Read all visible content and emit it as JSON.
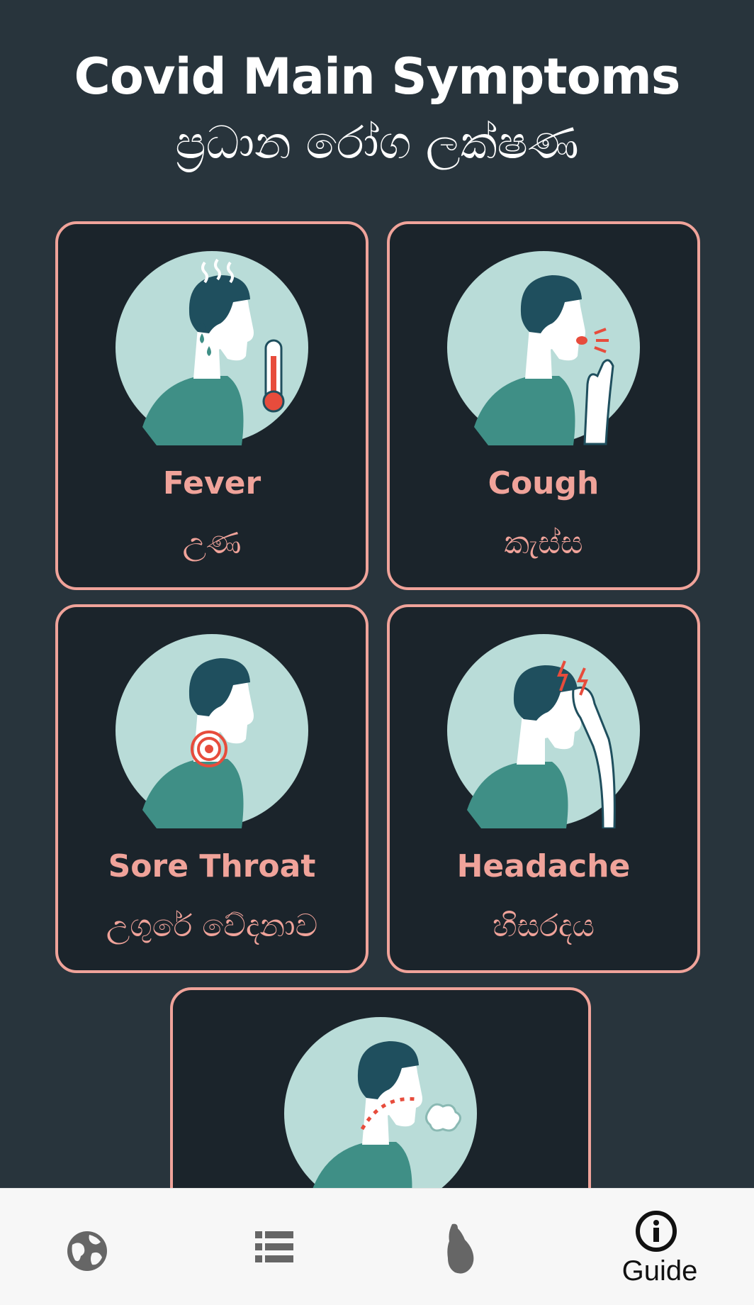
{
  "header": {
    "title_en": "Covid Main Symptoms",
    "title_si": "ප්‍රධාන රෝග ලක්ෂණ"
  },
  "symptoms": [
    {
      "name_en": "Fever",
      "name_si": "උණ",
      "icon": "fever-illustration"
    },
    {
      "name_en": "Cough",
      "name_si": "කැස්ස",
      "icon": "cough-illustration"
    },
    {
      "name_en": "Sore Throat",
      "name_si": "උගුරේ වේදනාව",
      "icon": "sore-throat-illustration"
    },
    {
      "name_en": "Headache",
      "name_si": "හිසරදය",
      "icon": "headache-illustration"
    },
    {
      "name_en": "",
      "name_si": "",
      "icon": "breathing-difficulty-illustration"
    }
  ],
  "bottom_nav": {
    "items": [
      {
        "icon": "globe-icon",
        "label": ""
      },
      {
        "icon": "list-icon",
        "label": ""
      },
      {
        "icon": "sri-lanka-map-icon",
        "label": ""
      },
      {
        "icon": "info-icon",
        "label": "Guide",
        "active": true
      }
    ]
  },
  "colors": {
    "background": "#28343c",
    "card_background": "#1b242b",
    "accent": "#f0a39a",
    "illustration_bg": "#b9dcd8",
    "hair": "#1f4f5e",
    "shirt": "#3f8f86",
    "nav_bg": "#f7f7f7"
  }
}
